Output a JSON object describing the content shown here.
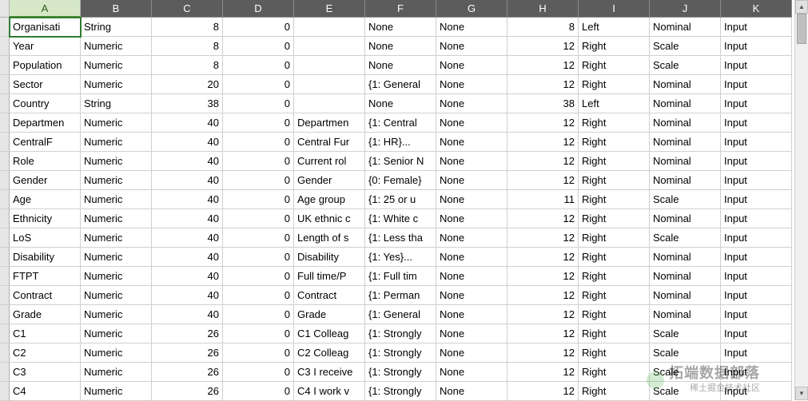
{
  "columns": [
    "A",
    "B",
    "C",
    "D",
    "E",
    "F",
    "G",
    "H",
    "I",
    "J",
    "K"
  ],
  "active_cell": {
    "row": 0,
    "col": 0
  },
  "watermark": {
    "main": "拓端数据部落",
    "sub": "稀土掘金技术社区"
  },
  "rows": [
    {
      "A": "Organisati",
      "B": "String",
      "C": "8",
      "D": "0",
      "E": "",
      "F": "None",
      "G": "None",
      "H": "8",
      "I": "Left",
      "J": "Nominal",
      "K": "Input"
    },
    {
      "A": "Year",
      "B": "Numeric",
      "C": "8",
      "D": "0",
      "E": "",
      "F": "None",
      "G": "None",
      "H": "12",
      "I": "Right",
      "J": "Scale",
      "K": "Input"
    },
    {
      "A": "Population",
      "B": "Numeric",
      "C": "8",
      "D": "0",
      "E": "",
      "F": "None",
      "G": "None",
      "H": "12",
      "I": "Right",
      "J": "Scale",
      "K": "Input"
    },
    {
      "A": "Sector",
      "B": "Numeric",
      "C": "20",
      "D": "0",
      "E": "",
      "F": "{1: General",
      "G": "None",
      "H": "12",
      "I": "Right",
      "J": "Nominal",
      "K": "Input"
    },
    {
      "A": "Country",
      "B": "String",
      "C": "38",
      "D": "0",
      "E": "",
      "F": "None",
      "G": "None",
      "H": "38",
      "I": "Left",
      "J": "Nominal",
      "K": "Input"
    },
    {
      "A": "Departmen",
      "B": "Numeric",
      "C": "40",
      "D": "0",
      "E": "Departmen",
      "F": "{1: Central",
      "G": "None",
      "H": "12",
      "I": "Right",
      "J": "Nominal",
      "K": "Input"
    },
    {
      "A": "CentralF",
      "B": "Numeric",
      "C": "40",
      "D": "0",
      "E": "Central Fur",
      "F": "{1: HR}...",
      "G": "None",
      "H": "12",
      "I": "Right",
      "J": "Nominal",
      "K": "Input"
    },
    {
      "A": "Role",
      "B": "Numeric",
      "C": "40",
      "D": "0",
      "E": "Current rol",
      "F": "{1: Senior N",
      "G": "None",
      "H": "12",
      "I": "Right",
      "J": "Nominal",
      "K": "Input"
    },
    {
      "A": "Gender",
      "B": "Numeric",
      "C": "40",
      "D": "0",
      "E": "Gender",
      "F": "{0: Female}",
      "G": "None",
      "H": "12",
      "I": "Right",
      "J": "Nominal",
      "K": "Input"
    },
    {
      "A": "Age",
      "B": "Numeric",
      "C": "40",
      "D": "0",
      "E": "Age group",
      "F": "{1: 25 or u",
      "G": "None",
      "H": "11",
      "I": "Right",
      "J": "Scale",
      "K": "Input"
    },
    {
      "A": "Ethnicity",
      "B": "Numeric",
      "C": "40",
      "D": "0",
      "E": "UK ethnic c",
      "F": "{1: White c",
      "G": "None",
      "H": "12",
      "I": "Right",
      "J": "Nominal",
      "K": "Input"
    },
    {
      "A": "LoS",
      "B": "Numeric",
      "C": "40",
      "D": "0",
      "E": "Length of s",
      "F": "{1: Less tha",
      "G": "None",
      "H": "12",
      "I": "Right",
      "J": "Scale",
      "K": "Input"
    },
    {
      "A": "Disability",
      "B": "Numeric",
      "C": "40",
      "D": "0",
      "E": "Disability",
      "F": "{1: Yes}...",
      "G": "None",
      "H": "12",
      "I": "Right",
      "J": "Nominal",
      "K": "Input"
    },
    {
      "A": "FTPT",
      "B": "Numeric",
      "C": "40",
      "D": "0",
      "E": "Full time/P",
      "F": "{1: Full tim",
      "G": "None",
      "H": "12",
      "I": "Right",
      "J": "Nominal",
      "K": "Input"
    },
    {
      "A": "Contract",
      "B": "Numeric",
      "C": "40",
      "D": "0",
      "E": "Contract",
      "F": "{1: Perman",
      "G": "None",
      "H": "12",
      "I": "Right",
      "J": "Nominal",
      "K": "Input"
    },
    {
      "A": "Grade",
      "B": "Numeric",
      "C": "40",
      "D": "0",
      "E": "Grade",
      "F": "{1: General",
      "G": "None",
      "H": "12",
      "I": "Right",
      "J": "Nominal",
      "K": "Input"
    },
    {
      "A": "C1",
      "B": "Numeric",
      "C": "26",
      "D": "0",
      "E": "C1 Colleag",
      "F": "{1: Strongly",
      "G": "None",
      "H": "12",
      "I": "Right",
      "J": "Scale",
      "K": "Input"
    },
    {
      "A": "C2",
      "B": "Numeric",
      "C": "26",
      "D": "0",
      "E": "C2 Colleag",
      "F": "{1: Strongly",
      "G": "None",
      "H": "12",
      "I": "Right",
      "J": "Scale",
      "K": "Input"
    },
    {
      "A": "C3",
      "B": "Numeric",
      "C": "26",
      "D": "0",
      "E": "C3 I receive",
      "F": "{1: Strongly",
      "G": "None",
      "H": "12",
      "I": "Right",
      "J": "Scale",
      "K": "Input"
    },
    {
      "A": "C4",
      "B": "Numeric",
      "C": "26",
      "D": "0",
      "E": "C4 I work v",
      "F": "{1: Strongly",
      "G": "None",
      "H": "12",
      "I": "Right",
      "J": "Scale",
      "K": "Input"
    }
  ],
  "numeric_cols": [
    "C",
    "D",
    "H"
  ]
}
